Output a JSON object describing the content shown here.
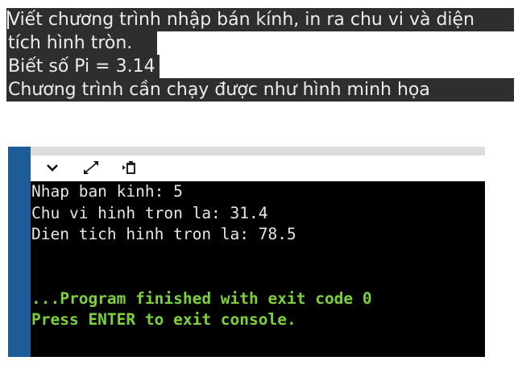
{
  "task": {
    "lines": [
      "Viết chương trình nhập bán kính, in ra chu vi và diện",
      "tích hình tròn.",
      "Biết số Pi = 3.14",
      "Chương trình cần chạy được như hình minh họa"
    ]
  },
  "console": {
    "toolbar": {
      "icons": [
        "chevron-down-icon",
        "expand-icon",
        "paste-icon"
      ]
    },
    "output_lines": [
      "Nhap ban kinh: 5",
      "Chu vi hinh tron la: 31.4",
      "Dien tich hinh tron la: 78.5"
    ],
    "status_lines": [
      "...Program finished with exit code 0",
      "Press ENTER to exit console."
    ]
  }
}
